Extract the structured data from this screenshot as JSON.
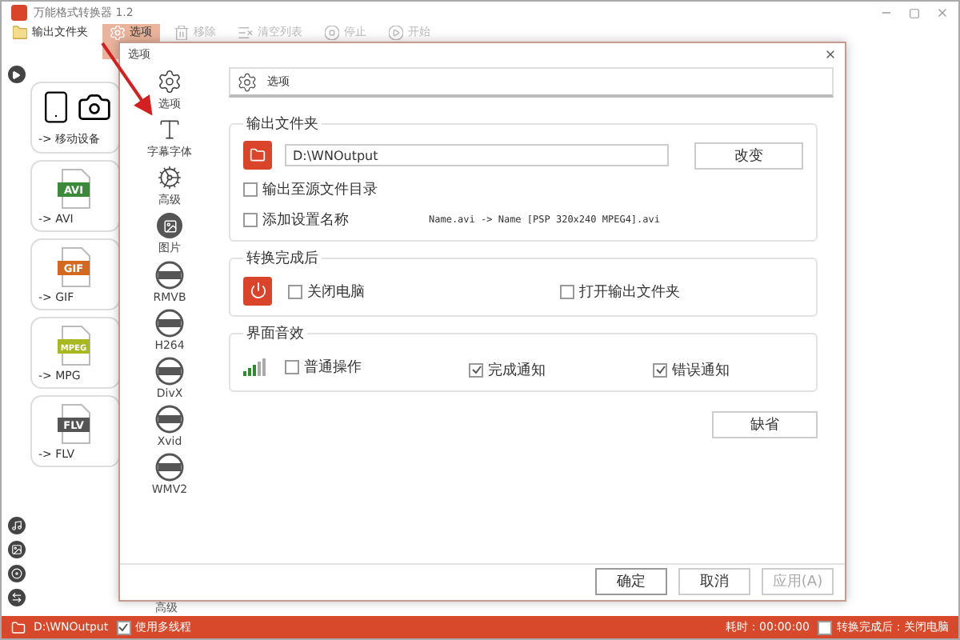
{
  "window": {
    "title": "万能格式转换器 1.2"
  },
  "toolbar": [
    {
      "label": "输出文件夹",
      "kind": "folder",
      "selected": false,
      "disabled": false
    },
    {
      "label": "选项",
      "kind": "gear",
      "selected": true,
      "disabled": false
    },
    {
      "label": "移除",
      "kind": "remove",
      "selected": false,
      "disabled": true
    },
    {
      "label": "清空列表",
      "kind": "clear",
      "selected": false,
      "disabled": true
    },
    {
      "label": "停止",
      "kind": "stop",
      "selected": false,
      "disabled": true
    },
    {
      "label": "开始",
      "kind": "start",
      "selected": false,
      "disabled": true
    }
  ],
  "presets": [
    {
      "label": "-> 移动设备",
      "kind": "device"
    },
    {
      "label": "-> AVI",
      "kind": "file",
      "badge": "AVI",
      "color": "#3a8a3a"
    },
    {
      "label": "-> GIF",
      "kind": "file",
      "badge": "GIF",
      "color": "#d2691e"
    },
    {
      "label": "-> MPG",
      "kind": "file",
      "badge": "MPEG",
      "color": "#a8b820"
    },
    {
      "label": "-> FLV",
      "kind": "file",
      "badge": "FLV",
      "color": "#555555"
    }
  ],
  "background_label": "高级",
  "status_bar": {
    "path": "D:\\WNOutput",
    "multithread": {
      "label": "使用多线程",
      "checked": true
    },
    "elapsed": "耗时：00:00:00",
    "after_done": {
      "label": "转换完成后：关闭电脑",
      "checked": false
    }
  },
  "dialog": {
    "title": "选项",
    "nav": [
      {
        "label": "选项",
        "kind": "gear"
      },
      {
        "label": "字幕字体",
        "kind": "font"
      },
      {
        "label": "高级",
        "kind": "cog"
      },
      {
        "label": "图片",
        "kind": "image"
      },
      {
        "label": "RMVB",
        "kind": "codec"
      },
      {
        "label": "H264",
        "kind": "codec"
      },
      {
        "label": "DivX",
        "kind": "codec"
      },
      {
        "label": "Xvid",
        "kind": "codec"
      },
      {
        "label": "WMV2",
        "kind": "codec"
      }
    ],
    "header": "选项",
    "output_folder": {
      "title": "输出文件夹",
      "path": "D:\\WNOutput",
      "change_button": "改变",
      "options": [
        {
          "label": "输出至源文件目录",
          "checked": false
        },
        {
          "label": "添加设置名称",
          "checked": false
        }
      ],
      "name_example": "Name.avi  -> Name [PSP 320x240 MPEG4].avi"
    },
    "after_conversion": {
      "title": "转换完成后",
      "options": [
        {
          "label": "关闭电脑",
          "checked": false
        },
        {
          "label": "打开输出文件夹",
          "checked": false
        }
      ]
    },
    "sound": {
      "title": "界面音效",
      "options": [
        {
          "label": "普通操作",
          "checked": false
        },
        {
          "label": "完成通知",
          "checked": true
        },
        {
          "label": "错误通知",
          "checked": true
        }
      ]
    },
    "default_button": "缺省",
    "buttons": [
      {
        "label": "确定",
        "disabled": false,
        "selected": true
      },
      {
        "label": "取消",
        "disabled": false,
        "selected": false
      },
      {
        "label": "应用(A)",
        "disabled": true,
        "selected": false
      }
    ]
  }
}
